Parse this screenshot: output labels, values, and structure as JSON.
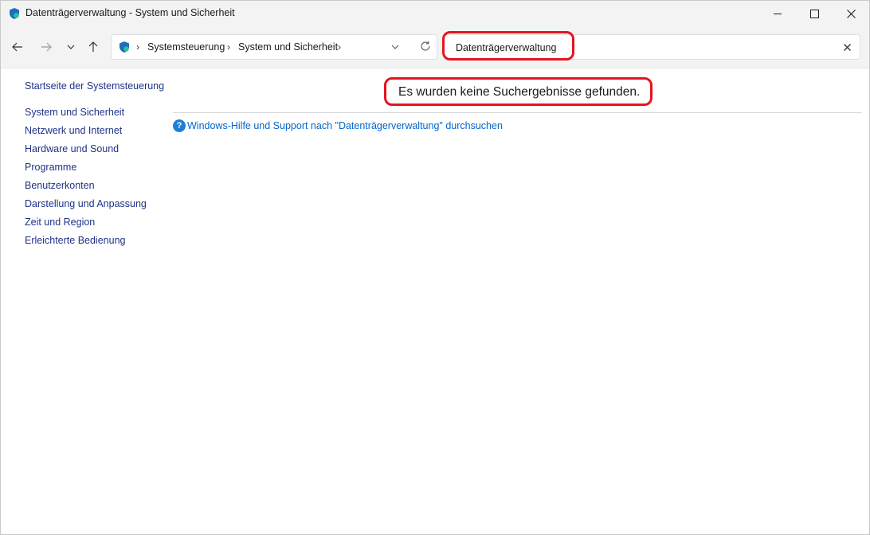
{
  "window": {
    "title": "Datenträgerverwaltung - System und Sicherheit"
  },
  "navigation": {
    "breadcrumbs": [
      "Systemsteuerung",
      "System und Sicherheit"
    ],
    "search_value": "Datenträgerverwaltung"
  },
  "sidebar": {
    "home_label": "Startseite der Systemsteuerung",
    "items": [
      {
        "label": "System und Sicherheit"
      },
      {
        "label": "Netzwerk und Internet"
      },
      {
        "label": "Hardware und Sound"
      },
      {
        "label": "Programme"
      },
      {
        "label": "Benutzerkonten"
      },
      {
        "label": "Darstellung und Anpassung"
      },
      {
        "label": "Zeit und Region"
      },
      {
        "label": "Erleichterte Bedienung"
      }
    ]
  },
  "main": {
    "no_results_text": "Es wurden keine Suchergebnisse gefunden.",
    "help_link_text": "Windows-Hilfe und Support nach \"Datenträgerverwaltung\" durchsuchen",
    "help_icon_glyph": "?"
  },
  "colors": {
    "link": "#1e3287",
    "help_link": "#0066cc",
    "annotation_red": "#e5141f",
    "chrome_bg": "#f3f3f3"
  },
  "icons": {
    "app": "control-panel-shield-icon",
    "back": "arrow-left-icon",
    "forward": "arrow-right-icon",
    "recent": "chevron-down-icon",
    "up": "arrow-up-icon",
    "refresh": "refresh-icon",
    "clear": "close-icon",
    "help": "help-icon"
  }
}
